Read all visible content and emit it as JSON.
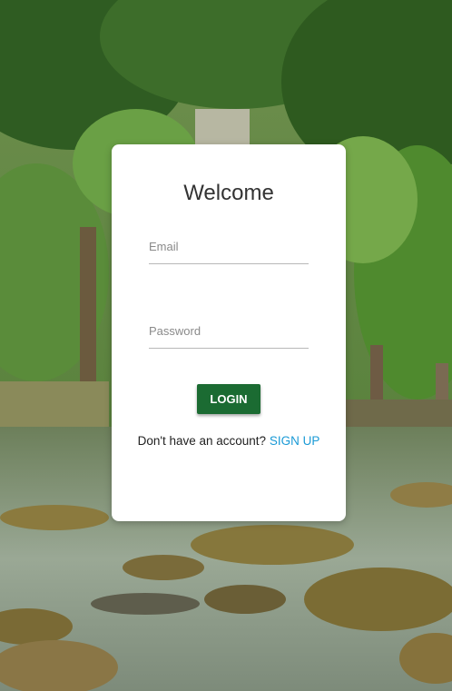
{
  "login": {
    "title": "Welcome",
    "email_placeholder": "Email",
    "password_placeholder": "Password",
    "login_button": "LOGIN",
    "signup_prompt": "Don't have an account?",
    "signup_link": "SIGN UP"
  },
  "colors": {
    "button_bg": "#1b6b32",
    "link": "#1a9ad6",
    "card_bg": "#ffffff"
  }
}
